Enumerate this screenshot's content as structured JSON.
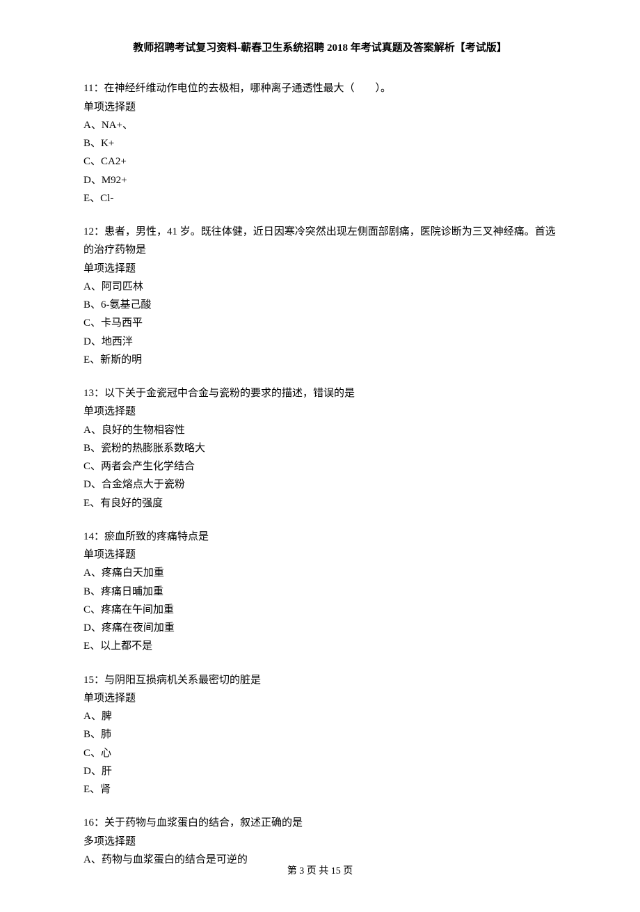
{
  "header": "教师招聘考试复习资料-蕲春卫生系统招聘 2018 年考试真题及答案解析【考试版】",
  "questions": [
    {
      "stem": "11：在神经纤维动作电位的去极相，哪种离子通透性最大（　　）。",
      "type": "单项选择题",
      "options": [
        "A、NA+、",
        "B、K+",
        "C、CA2+",
        "D、M92+",
        "E、Cl-"
      ]
    },
    {
      "stem": "12：患者，男性，41 岁。既往体健，近日因寒冷突然出现左侧面部剧痛，医院诊断为三叉神经痛。首选的治疗药物是",
      "type": "单项选择题",
      "options": [
        "A、阿司匹林",
        "B、6-氨基己酸",
        "C、卡马西平",
        "D、地西泮",
        "E、新斯的明"
      ]
    },
    {
      "stem": "13：以下关于金瓷冠中合金与瓷粉的要求的描述，错误的是",
      "type": "单项选择题",
      "options": [
        "A、良好的生物相容性",
        "B、瓷粉的热膨胀系数略大",
        "C、两者会产生化学结合",
        "D、合金熔点大于瓷粉",
        "E、有良好的强度"
      ]
    },
    {
      "stem": "14：瘀血所致的疼痛特点是",
      "type": "单项选择题",
      "options": [
        "A、疼痛白天加重",
        "B、疼痛日晡加重",
        "C、疼痛在午间加重",
        "D、疼痛在夜间加重",
        "E、以上都不是"
      ]
    },
    {
      "stem": "15：与阴阳互损病机关系最密切的脏是",
      "type": "单项选择题",
      "options": [
        "A、脾",
        "B、肺",
        "C、心",
        "D、肝",
        "E、肾"
      ]
    },
    {
      "stem": "16：关于药物与血浆蛋白的结合，叙述正确的是",
      "type": "多项选择题",
      "options": [
        "A、药物与血浆蛋白的结合是可逆的"
      ]
    }
  ],
  "footer": "第 3 页 共 15 页"
}
